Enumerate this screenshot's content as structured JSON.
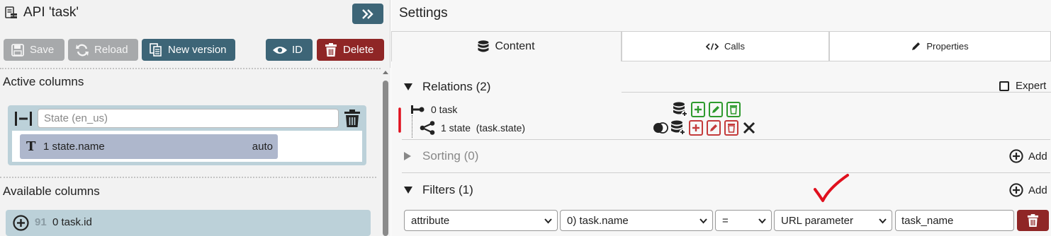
{
  "left": {
    "title": "API 'task'",
    "icons": {
      "title": "server-doc-icon",
      "expand": "double-chevron-right-icon"
    },
    "toolbar": {
      "save_label": "Save",
      "reload_label": "Reload",
      "new_version_label": "New version",
      "id_label": "ID",
      "delete_label": "Delete"
    },
    "active_columns": {
      "label": "Active columns",
      "group": {
        "placeholder": "State (en_us)",
        "columns": [
          {
            "type_glyph": "T",
            "label": "1 state.name",
            "mode": "auto"
          }
        ]
      }
    },
    "available_columns": {
      "label": "Available columns",
      "items": [
        {
          "count": "91",
          "label": "0 task.id"
        }
      ]
    }
  },
  "right": {
    "title": "Settings",
    "tabs": [
      {
        "label": "Content",
        "icon": "database-icon",
        "active": true
      },
      {
        "label": "Calls",
        "icon": "code-icon",
        "active": false
      },
      {
        "label": "Properties",
        "icon": "pencil-icon",
        "active": false
      }
    ],
    "relations": {
      "label": "Relations (2)",
      "expanded": true,
      "expert_label": "Expert",
      "items": [
        {
          "label": "0 task"
        },
        {
          "label": "1 state  (task.state)"
        }
      ]
    },
    "sorting": {
      "label": "Sorting (0)",
      "expanded": false,
      "add_label": "Add"
    },
    "filters": {
      "label": "Filters (1)",
      "expanded": true,
      "add_label": "Add",
      "rows": [
        {
          "kind": "attribute",
          "field": "0) task.name",
          "operator": "=",
          "mode": "URL parameter",
          "value": "task_name"
        }
      ]
    }
  },
  "colors": {
    "accent": "#3d6577",
    "danger": "#8f2626",
    "disabled": "#a7a9ab",
    "column_group": "#bcd1d9",
    "column_chip": "#aeb7cc",
    "green_action": "#2e9a2e",
    "red_action": "#c43b3b",
    "annotation_red": "#e0101e"
  }
}
